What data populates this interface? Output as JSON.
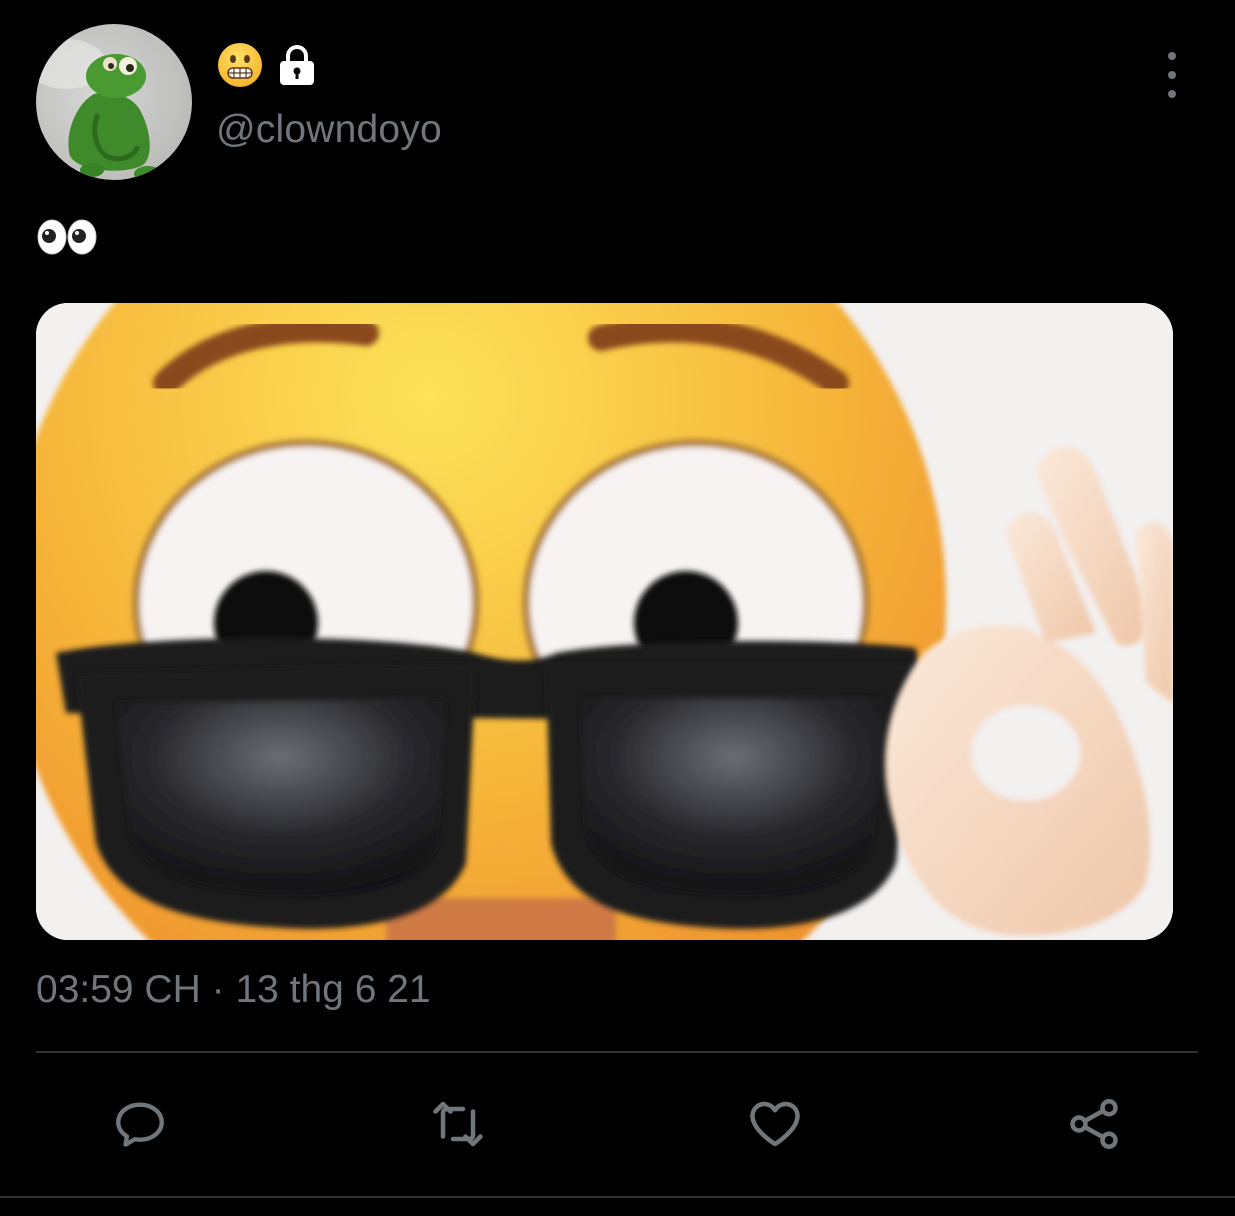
{
  "author": {
    "avatar_icon": "green-plush-frog-avatar",
    "name_emoji": "grimacing-face-emoji",
    "locked_icon": "lock-icon",
    "handle": "@clowndoyo"
  },
  "more_icon": "more-vertical-icon",
  "tweet": {
    "text_emoji": "eyes-emoji",
    "media_description_icon": "sunglasses-emoji-media",
    "time": "03:59 CH",
    "separator": " · ",
    "date": "13 thg 6 21"
  },
  "actions": {
    "reply_icon": "reply-icon",
    "retweet_icon": "retweet-icon",
    "like_icon": "heart-icon",
    "share_icon": "share-icon"
  },
  "colors": {
    "background": "#000000",
    "secondary_text": "#71767b",
    "divider": "#2f3336"
  }
}
